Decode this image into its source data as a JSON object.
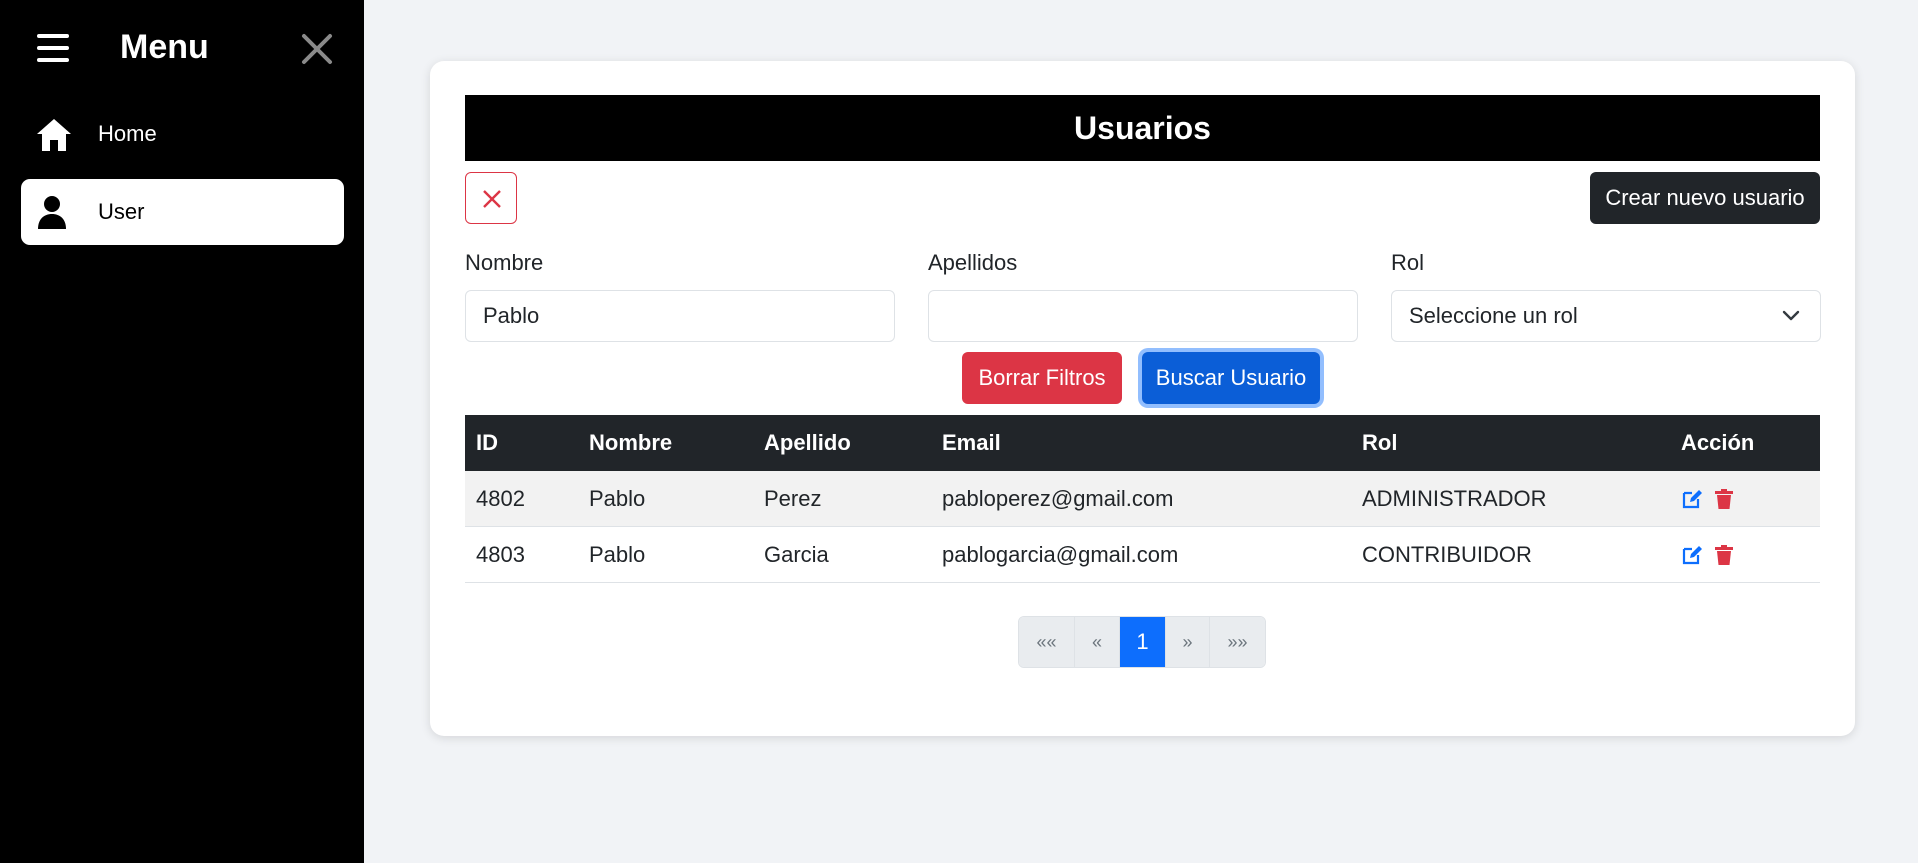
{
  "sidebar": {
    "title": "Menu",
    "items": [
      {
        "label": "Home",
        "icon": "home-icon",
        "active": false
      },
      {
        "label": "User",
        "icon": "user-icon",
        "active": true
      }
    ]
  },
  "page": {
    "title": "Usuarios",
    "create_button": "Crear nuevo usuario",
    "clear_icon_label": "X"
  },
  "filters": {
    "nombre": {
      "label": "Nombre",
      "value": "Pablo"
    },
    "apellidos": {
      "label": "Apellidos",
      "value": ""
    },
    "rol": {
      "label": "Rol",
      "selected": "Seleccione un rol"
    },
    "clear_button": "Borrar Filtros",
    "search_button": "Buscar Usuario"
  },
  "table": {
    "headers": [
      "ID",
      "Nombre",
      "Apellido",
      "Email",
      "Rol",
      "Acción"
    ],
    "rows": [
      {
        "id": "4802",
        "nombre": "Pablo",
        "apellido": "Perez",
        "email": "pabloperez@gmail.com",
        "rol": "ADMINISTRADOR"
      },
      {
        "id": "4803",
        "nombre": "Pablo",
        "apellido": "Garcia",
        "email": "pablogarcia@gmail.com",
        "rol": "CONTRIBUIDOR"
      }
    ]
  },
  "pagination": {
    "first": "««",
    "prev": "«",
    "current": "1",
    "next": "»",
    "last": "»»"
  },
  "colors": {
    "sidebar_bg": "#000000",
    "primary": "#0d6efd",
    "danger": "#dc3545",
    "dark": "#212529"
  }
}
